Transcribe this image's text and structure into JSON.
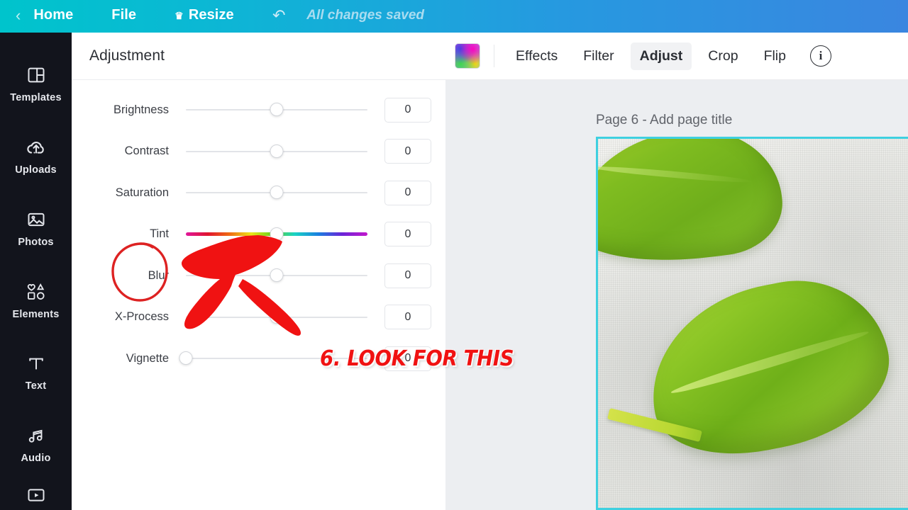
{
  "topbar": {
    "back_icon": "chevron-left-icon",
    "home_label": "Home",
    "file_label": "File",
    "resize_label": "Resize",
    "resize_icon": "crown-icon",
    "undo_icon": "undo-icon",
    "status_text": "All changes saved"
  },
  "sidebar": {
    "items": [
      {
        "label": "Templates",
        "icon": "templates-icon"
      },
      {
        "label": "Uploads",
        "icon": "upload-cloud-icon"
      },
      {
        "label": "Photos",
        "icon": "photo-icon"
      },
      {
        "label": "Elements",
        "icon": "shapes-icon"
      },
      {
        "label": "Text",
        "icon": "text-icon"
      },
      {
        "label": "Audio",
        "icon": "audio-note-icon"
      },
      {
        "label": "",
        "icon": "video-icon"
      }
    ]
  },
  "panel": {
    "title": "Adjustment",
    "rows": [
      {
        "label": "Brightness",
        "value": "0",
        "knob_pct": 50,
        "track": "plain"
      },
      {
        "label": "Contrast",
        "value": "0",
        "knob_pct": 50,
        "track": "plain"
      },
      {
        "label": "Saturation",
        "value": "0",
        "knob_pct": 50,
        "track": "plain"
      },
      {
        "label": "Tint",
        "value": "0",
        "knob_pct": 50,
        "track": "rainbow"
      },
      {
        "label": "Blur",
        "value": "0",
        "knob_pct": 50,
        "track": "plain"
      },
      {
        "label": "X-Process",
        "value": "0",
        "knob_pct": 50,
        "track": "plain"
      },
      {
        "label": "Vignette",
        "value": "0",
        "knob_pct": 0,
        "track": "plain"
      }
    ]
  },
  "canvas_toolbar": {
    "swatch_icon": "color-gradient-swatch-icon",
    "tabs": [
      {
        "label": "Effects",
        "active": false
      },
      {
        "label": "Filter",
        "active": false
      },
      {
        "label": "Adjust",
        "active": true
      },
      {
        "label": "Crop",
        "active": false
      },
      {
        "label": "Flip",
        "active": false
      }
    ],
    "info_icon": "info-icon",
    "info_glyph": "i"
  },
  "canvas": {
    "page_label": "Page 6 - Add page title",
    "photo_alt": "spinach-leaves-on-linen-cloth",
    "selection_color": "#3ed0e0"
  },
  "annotations": {
    "callout_text": "6. LOOK FOR THIS",
    "circle_target": "Blur",
    "color": "#f01212"
  },
  "colors": {
    "topbar_start": "#00c4cc",
    "topbar_end": "#3a86e0",
    "rail_bg": "#12141c",
    "canvas_bg": "#eceef1",
    "accent_red": "#f01212"
  }
}
